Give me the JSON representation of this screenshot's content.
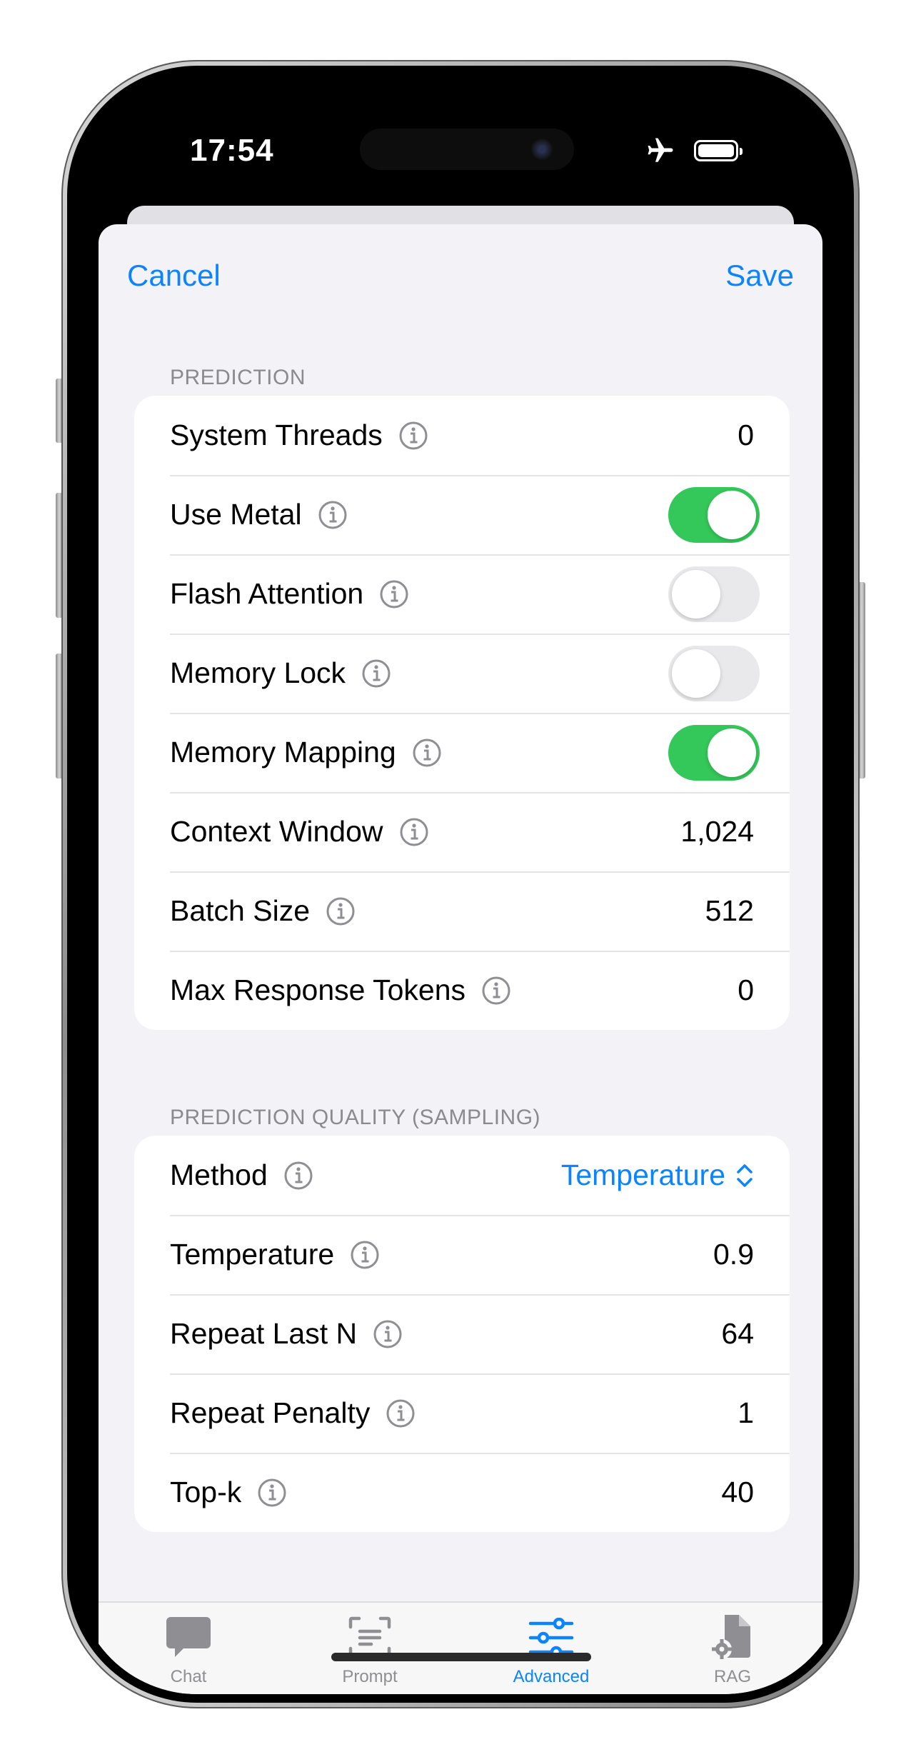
{
  "status": {
    "time": "17:54"
  },
  "nav": {
    "cancel": "Cancel",
    "save": "Save"
  },
  "sections": [
    {
      "header": "PREDICTION",
      "rows": [
        {
          "label": "System Threads",
          "value": "0"
        },
        {
          "label": "Use Metal",
          "toggle": true
        },
        {
          "label": "Flash Attention",
          "toggle": false
        },
        {
          "label": "Memory Lock",
          "toggle": false
        },
        {
          "label": "Memory Mapping",
          "toggle": true
        },
        {
          "label": "Context Window",
          "value": "1,024"
        },
        {
          "label": "Batch Size",
          "value": "512"
        },
        {
          "label": "Max Response Tokens",
          "value": "0"
        }
      ]
    },
    {
      "header": "PREDICTION QUALITY (SAMPLING)",
      "rows": [
        {
          "label": "Method",
          "picker": "Temperature"
        },
        {
          "label": "Temperature",
          "value": "0.9"
        },
        {
          "label": "Repeat Last N",
          "value": "64"
        },
        {
          "label": "Repeat Penalty",
          "value": "1"
        },
        {
          "label": "Top-k",
          "value": "40"
        }
      ]
    }
  ],
  "tabs": [
    {
      "label": "Chat",
      "icon": "chat-bubble-icon"
    },
    {
      "label": "Prompt",
      "icon": "prompt-icon"
    },
    {
      "label": "Advanced",
      "icon": "sliders-icon",
      "active": true
    },
    {
      "label": "RAG",
      "icon": "document-gear-icon"
    }
  ],
  "colors": {
    "accent": "#0a84ff",
    "toggle_on": "#34c759",
    "toggle_off": "#e9e9eb",
    "sheet_bg": "#f2f2f7"
  }
}
